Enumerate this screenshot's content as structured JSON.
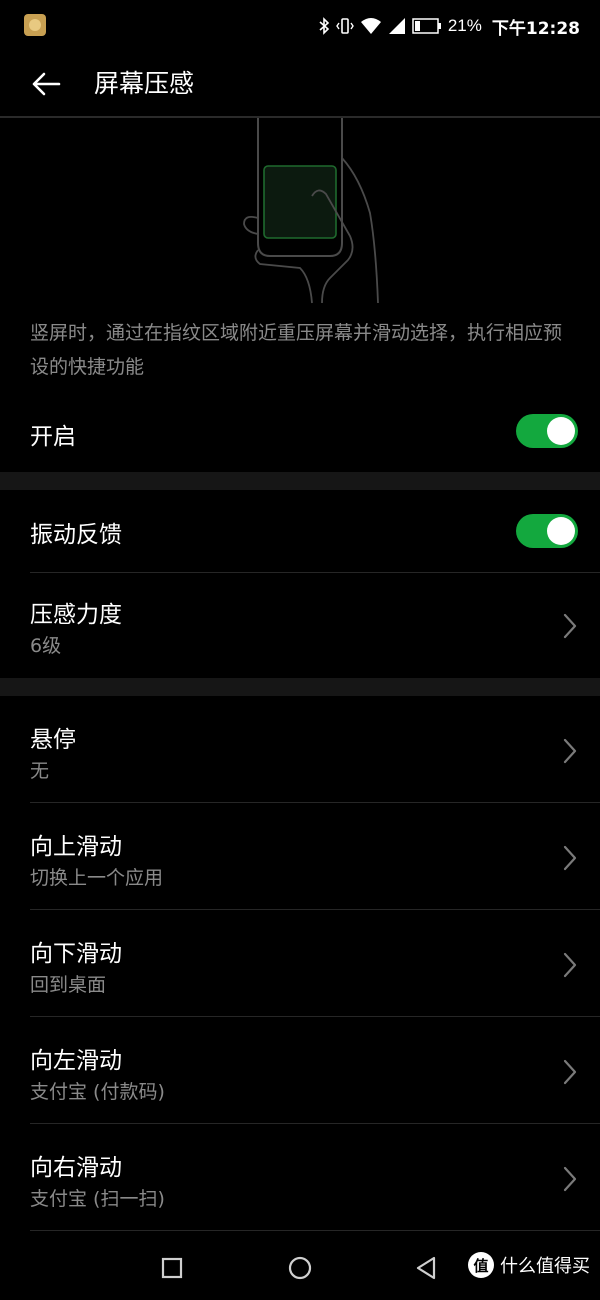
{
  "status_bar": {
    "battery_percent": "21%",
    "time": "下午12:28",
    "icons": [
      "app-notification-icon",
      "bluetooth-icon",
      "vibrate-icon",
      "wifi-icon",
      "signal-icon",
      "battery-icon"
    ]
  },
  "header": {
    "title": "屏幕压感",
    "back_icon": "arrow-left-icon"
  },
  "description": "竖屏时，通过在指纹区域附近重压屏幕并滑动选择，执行相应预设的快捷功能",
  "enable_row": {
    "label": "开启",
    "on": true
  },
  "vibration_row": {
    "label": "振动反馈",
    "on": true
  },
  "pressure_row": {
    "label": "压感力度",
    "value": "6级"
  },
  "gesture_rows": [
    {
      "label": "悬停",
      "value": "无"
    },
    {
      "label": "向上滑动",
      "value": "切换上一个应用"
    },
    {
      "label": "向下滑动",
      "value": "回到桌面"
    },
    {
      "label": "向左滑动",
      "value": "支付宝 (付款码)"
    },
    {
      "label": "向右滑动",
      "value": "支付宝 (扫一扫)"
    }
  ],
  "watermark": {
    "logo": "值",
    "text": "什么值得买"
  },
  "colors": {
    "toggle_on": "#13a83e",
    "background": "#000000",
    "secondary_text": "#8a8a8a",
    "section_gap": "#161616"
  }
}
